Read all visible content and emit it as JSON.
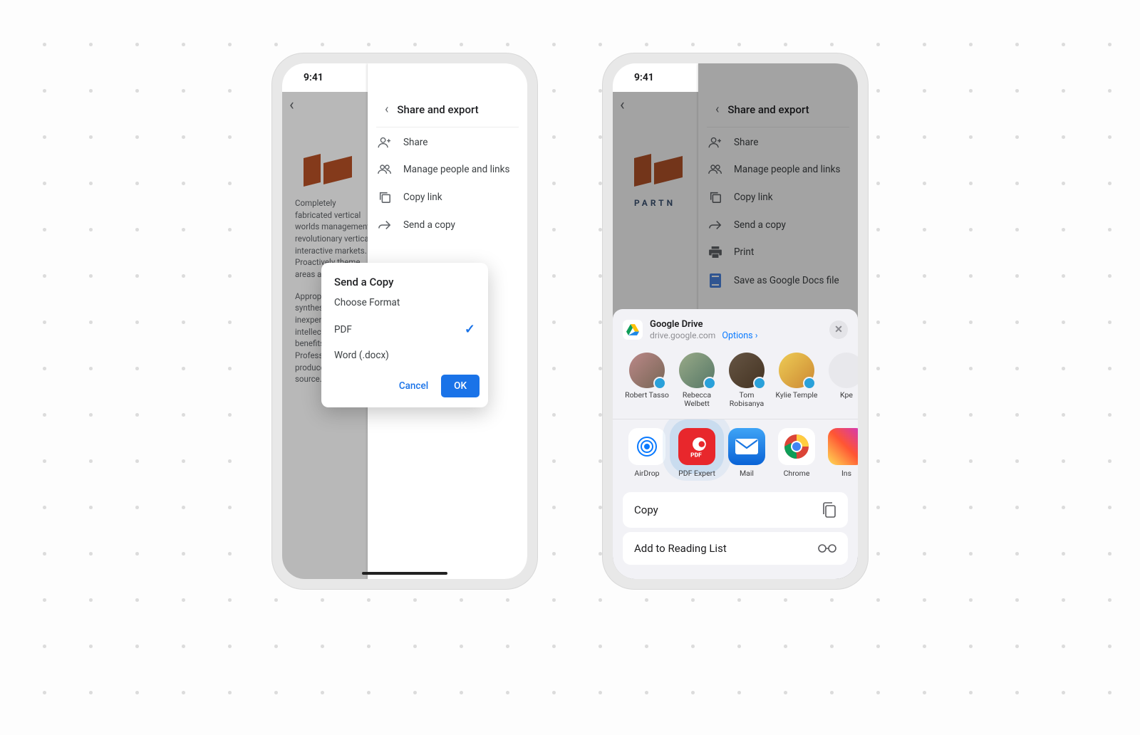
{
  "statusTime": "9:41",
  "panel": {
    "title": "Share and export",
    "items": [
      {
        "label": "Share"
      },
      {
        "label": "Manage people and links"
      },
      {
        "label": "Copy link"
      },
      {
        "label": "Send a copy"
      },
      {
        "label": "Print"
      },
      {
        "label": "Save as Google Docs file"
      }
    ]
  },
  "doc": {
    "partner": "PARTN",
    "p1": "Completely fabricated vertical worlds management revolutionary vertical interactive markets. Proactively theme areas and lo",
    "p2": "Appropriately synthesize inexpensive intellectual timely benefits with Professionally produce open-source."
  },
  "modal": {
    "title": "Send a Copy",
    "subtitle": "Choose Format",
    "opt1": "PDF",
    "opt2": "Word (.docx)",
    "cancel": "Cancel",
    "ok": "OK"
  },
  "sheet": {
    "app": "Google Drive",
    "host": "drive.google.com",
    "optionsLabel": "Options",
    "contacts": [
      {
        "name": "Robert Tasso"
      },
      {
        "name": "Rebecca Welbett"
      },
      {
        "name": "Tom Robisanya"
      },
      {
        "name": "Kylie Temple"
      },
      {
        "name": "Kpe"
      }
    ],
    "apps": [
      {
        "name": "AirDrop"
      },
      {
        "name": "PDF Expert"
      },
      {
        "name": "Mail"
      },
      {
        "name": "Chrome"
      },
      {
        "name": "Ins"
      }
    ],
    "actions": {
      "copy": "Copy",
      "reading": "Add to Reading List"
    }
  }
}
